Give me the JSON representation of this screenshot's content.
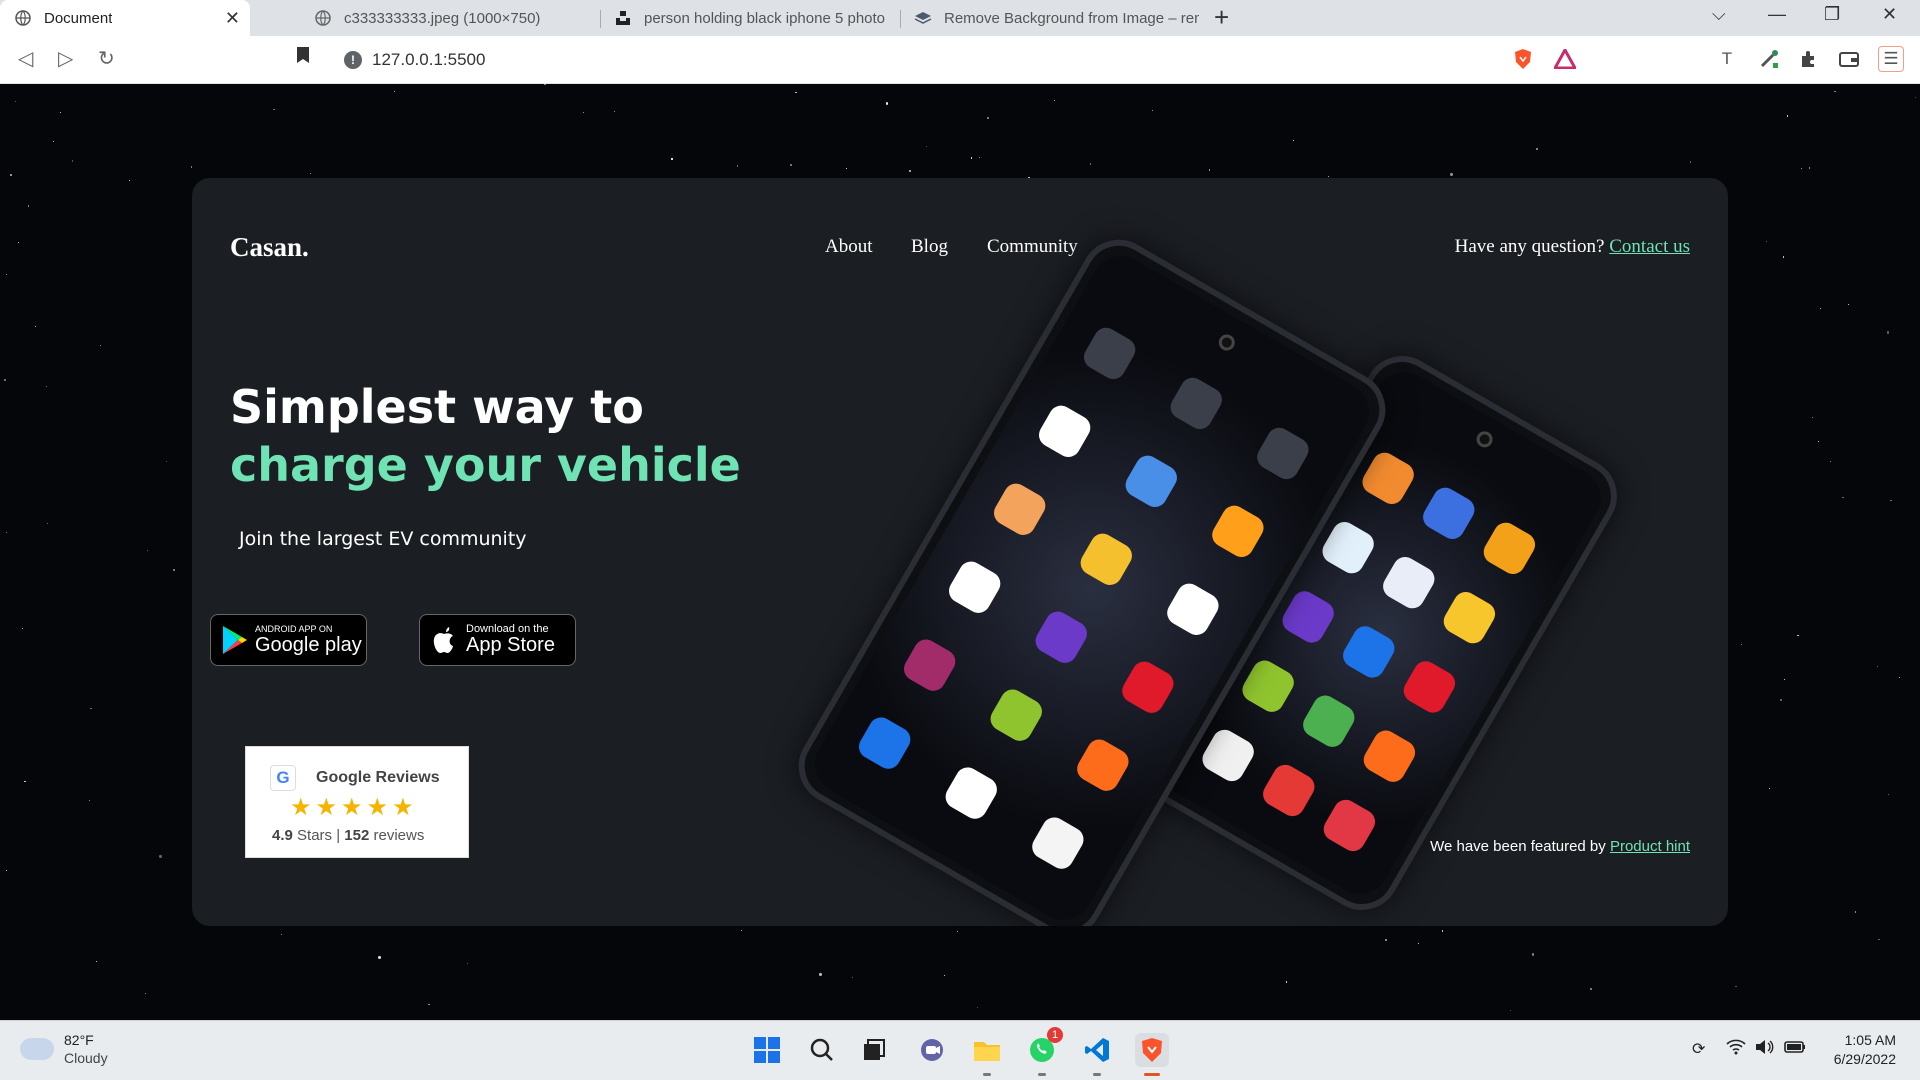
{
  "browser": {
    "tabs": [
      {
        "title": "Document",
        "active": true
      },
      {
        "title": "c333333333.jpeg (1000×750)",
        "active": false
      },
      {
        "title": "person holding black iphone 5 photo",
        "active": false
      },
      {
        "title": "Remove Background from Image – rem",
        "active": false
      }
    ],
    "url": "127.0.0.1:5500"
  },
  "site": {
    "logo": "Casan.",
    "nav": [
      "About",
      "Blog",
      "Community"
    ],
    "question_text": "Have any question?",
    "contact_link": "Contact us",
    "hero_line1": "Simplest way to",
    "hero_line2": "charge your vehicle",
    "subtitle": "Join the largest EV community",
    "google_play": {
      "small": "ANDROID APP ON",
      "big": "Google play"
    },
    "app_store": {
      "small": "Download on the",
      "big": "App Store"
    },
    "reviews": {
      "title": "Google Reviews",
      "stars": "★★★★★",
      "rating": "4.9",
      "rating_label": "Stars",
      "separator": "|",
      "count": "152",
      "count_label": "reviews"
    },
    "featured_text": "We have been featured by",
    "featured_link": "Product hint",
    "accent_color": "#6fe3b3"
  },
  "taskbar": {
    "weather_temp": "82°F",
    "weather_condition": "Cloudy",
    "time": "1:05 AM",
    "date": "6/29/2022",
    "whatsapp_badge": "1"
  }
}
